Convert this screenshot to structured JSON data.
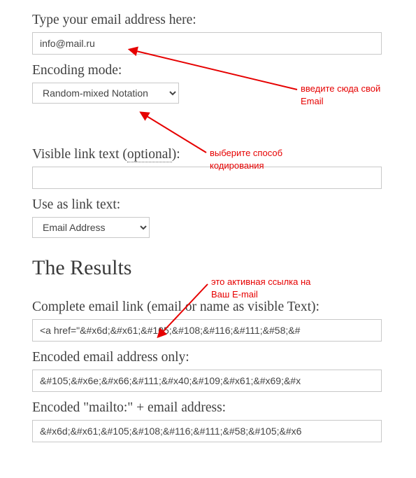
{
  "labels": {
    "email": "Type your email address here:",
    "encoding": "Encoding mode:",
    "visible_pre": "Visible link text (",
    "optional": "optional",
    "visible_post": "):",
    "use_as": "Use as link text:",
    "results_heading": "The Results",
    "complete_link": "Complete email link (email or name as visible Text):",
    "encoded_addr": "Encoded email address only:",
    "encoded_mailto": "Encoded \"mailto:\" + email address:"
  },
  "values": {
    "email": "info@mail.ru",
    "encoding_selected": "Random-mixed Notation",
    "visible_text": "",
    "use_as_selected": "Email Address",
    "result_complete": "<a href=\"&#x6d;&#x61;&#105;&#108;&#116;&#111;&#58;&#",
    "result_encoded_addr": "&#105;&#x6e;&#x66;&#111;&#x40;&#109;&#x61;&#x69;&#x",
    "result_encoded_mailto": "&#x6d;&#x61;&#105;&#108;&#116;&#111;&#58;&#105;&#x6"
  },
  "annotations": {
    "enter_email": "введите сюда свой\nEmail",
    "choose_encoding": "выберите способ\nкодирования",
    "active_link": "это активная ссылка на\nВаш E-mail"
  }
}
